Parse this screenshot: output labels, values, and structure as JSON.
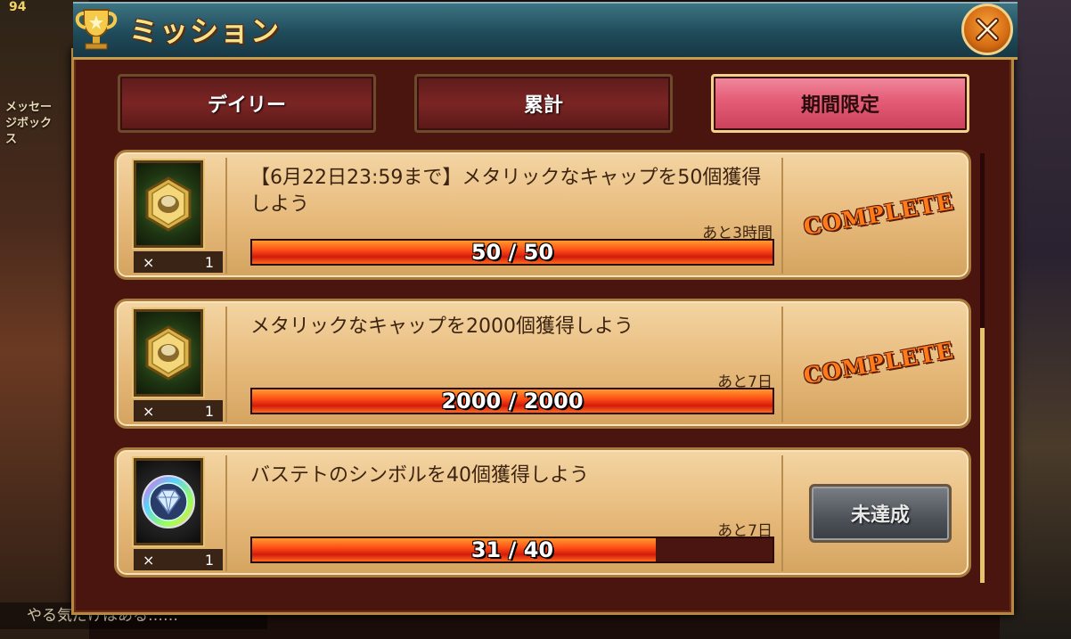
{
  "header": {
    "title": "ミッション"
  },
  "tabs": [
    {
      "label": "デイリー",
      "active": false
    },
    {
      "label": "累計",
      "active": false
    },
    {
      "label": "期間限定",
      "active": true
    }
  ],
  "missions": [
    {
      "text": "【6月22日23:59まで】メタリックなキャップを50個獲得しよう",
      "remaining": "あと3時間",
      "progress_text": "50 / 50",
      "progress": 1.0,
      "qty_label": "×",
      "qty": "1",
      "status": "COMPLETE",
      "icon": "metallic-cap-medal-icon"
    },
    {
      "text": "メタリックなキャップを2000個獲得しよう",
      "remaining": "あと7日",
      "progress_text": "2000 / 2000",
      "progress": 1.0,
      "qty_label": "×",
      "qty": "1",
      "status": "COMPLETE",
      "icon": "metallic-cap-medal-icon"
    },
    {
      "text": "バステトのシンボルを40個獲得しよう",
      "remaining": "あと7日",
      "progress_text": "31 / 40",
      "progress": 0.775,
      "qty_label": "×",
      "qty": "1",
      "status": "未達成",
      "icon": "diamond-symbol-medal-icon"
    }
  ],
  "background": {
    "left_label": "メッセージボックス",
    "level": "94",
    "chat": "やる気だけはある……"
  },
  "colors": {
    "accent_gold": "#e6c46c",
    "bar_fill": "#ff4f16",
    "card_bg": "#e6b97a",
    "active_tab": "#e45c76"
  }
}
